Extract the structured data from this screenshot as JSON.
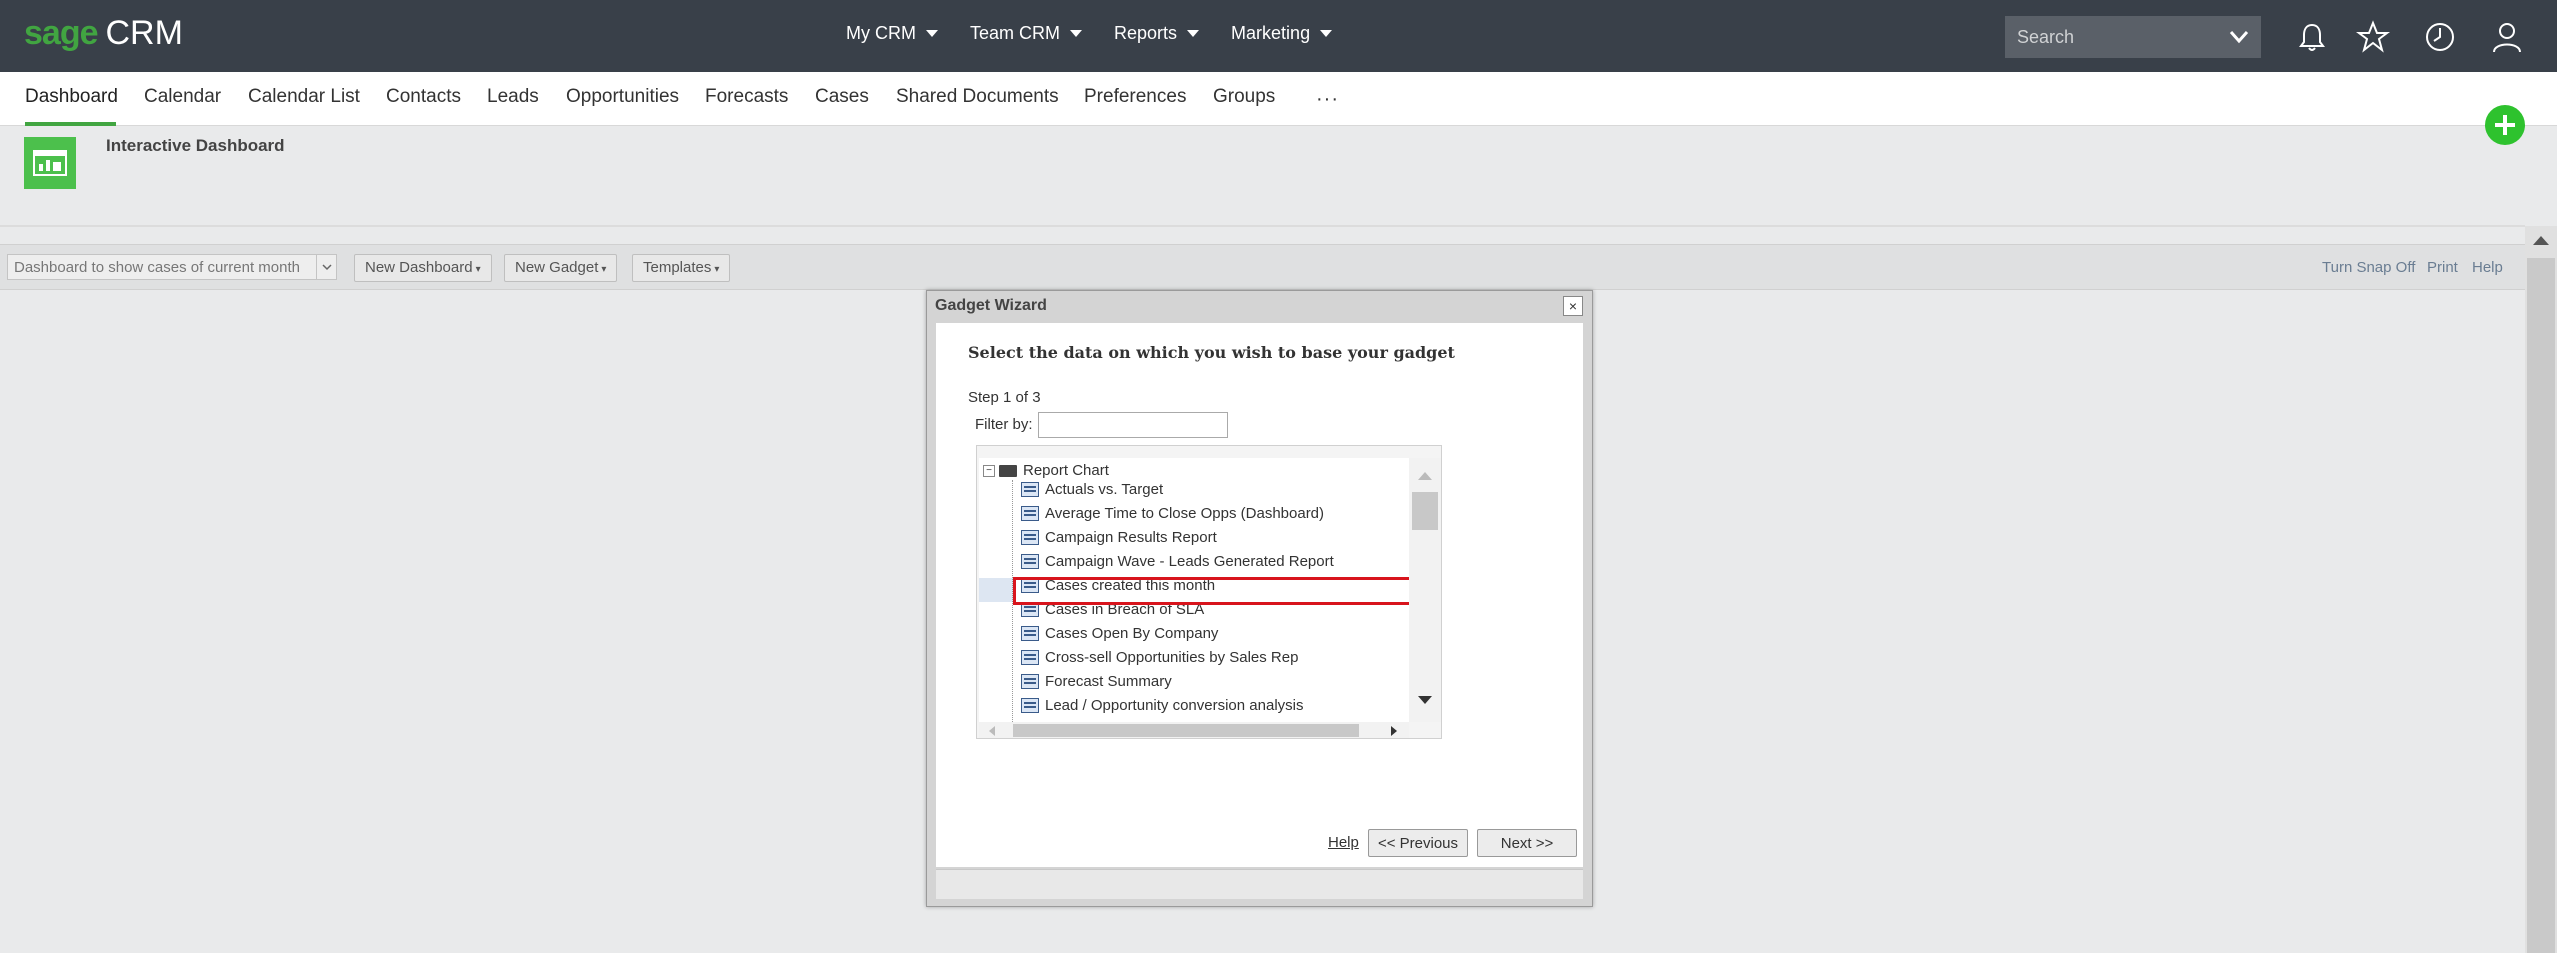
{
  "logo": {
    "brand": "sage",
    "product": "CRM"
  },
  "topnav": [
    {
      "label": "My CRM"
    },
    {
      "label": "Team CRM"
    },
    {
      "label": "Reports"
    },
    {
      "label": "Marketing"
    }
  ],
  "search": {
    "placeholder": "Search"
  },
  "subnav": {
    "items": [
      "Dashboard",
      "Calendar",
      "Calendar List",
      "Contacts",
      "Leads",
      "Opportunities",
      "Forecasts",
      "Cases",
      "Shared Documents",
      "Preferences",
      "Groups"
    ],
    "more": "···",
    "active": "Dashboard"
  },
  "header": {
    "title": "Interactive Dashboard"
  },
  "toolbar": {
    "dashboard_select": "Dashboard to show cases of current month",
    "new_dashboard": "New Dashboard",
    "new_gadget": "New Gadget",
    "templates": "Templates",
    "turn_snap_off": "Turn Snap Off",
    "print": "Print",
    "help": "Help"
  },
  "dialog": {
    "title": "Gadget Wizard",
    "close": "×",
    "heading": "Select the data on which you wish to base your gadget",
    "step": "Step 1 of 3",
    "filter_label": "Filter by:",
    "filter_value": "",
    "tree": {
      "root": "Report Chart",
      "expander": "−",
      "items": [
        "Actuals vs. Target",
        "Average Time to Close Opps (Dashboard)",
        "Campaign Results Report",
        "Campaign Wave - Leads Generated Report",
        "Cases created this month",
        "Cases in Breach of SLA",
        "Cases Open By Company",
        "Cross-sell Opportunities by Sales Rep",
        "Forecast Summary",
        "Lead / Opportunity conversion analysis"
      ],
      "selected": "Cases created this month"
    },
    "help": "Help",
    "previous": "<< Previous",
    "next": "Next >>"
  },
  "colors": {
    "topbar": "#394049",
    "brand_green": "#41a541",
    "highlight_red": "#d8141c",
    "add_button": "#2ec22e"
  },
  "icons": [
    "bell-icon",
    "star-icon",
    "clock-icon",
    "user-icon",
    "plus-icon",
    "dashboard-icon",
    "chevron-down-icon",
    "folder-icon",
    "report-icon",
    "close-icon"
  ]
}
